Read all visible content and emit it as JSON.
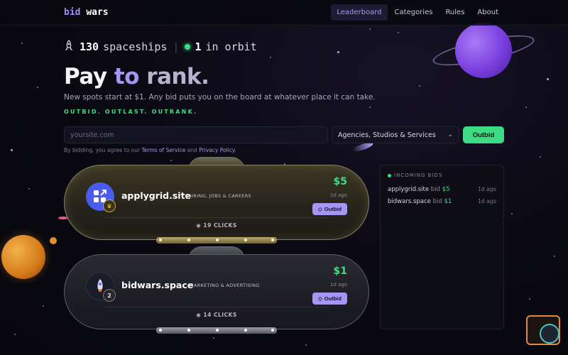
{
  "brand": {
    "part1": "bid",
    "part2": "wars"
  },
  "nav": {
    "items": [
      {
        "label": "Leaderboard",
        "active": true
      },
      {
        "label": "Categories",
        "active": false
      },
      {
        "label": "Rules",
        "active": false
      },
      {
        "label": "About",
        "active": false
      }
    ]
  },
  "stats": {
    "ship_icon": "rocket-icon",
    "ships_count": "130",
    "ships_label": "spaceships",
    "orbit_count": "1",
    "orbit_label": "in orbit"
  },
  "hero": {
    "title_word1": "Pay",
    "title_word2": "to",
    "title_word3": "rank.",
    "subtitle": "New spots start at $1. Any bid puts you on the board at whatever place it can take.",
    "tagline": "OUTBID. OUTLAST. OUTRANK."
  },
  "form": {
    "site_placeholder": "yoursite.com",
    "category_selected": "Agencies, Studios & Services",
    "submit_label": "Outbid",
    "terms_prefix": "By bidding, you agree to our",
    "terms_link": "Terms of Service",
    "terms_and": "and",
    "privacy_link": "Privacy Policy",
    "terms_suffix": "."
  },
  "leaderboard": [
    {
      "rank": "1",
      "rank_icon": "crown-icon",
      "site": "applygrid.site",
      "category": "HIRING, JOBS & CAREERS",
      "price": "$5",
      "ago": "1d ago",
      "button": "Outbid",
      "clicks": "19 CLICKS",
      "tier": "gold"
    },
    {
      "rank": "2",
      "rank_icon": "",
      "site": "bidwars.space",
      "category": "MARKETING & ADVERTISING",
      "price": "$1",
      "ago": "1d ago",
      "button": "Outbid",
      "clicks": "14 CLICKS",
      "tier": "silver"
    }
  ],
  "incoming": {
    "title": "INCOMING BIDS",
    "rows": [
      {
        "site": "applygrid.site",
        "verb": "bid",
        "amount": "$5",
        "when": "1d ago"
      },
      {
        "site": "bidwars.space",
        "verb": "bid",
        "amount": "$1",
        "when": "1d ago"
      }
    ]
  },
  "colors": {
    "accent_purple": "#a596f2",
    "accent_green": "#3ddc84",
    "gold": "#8b8160",
    "silver": "#5c5e68"
  }
}
